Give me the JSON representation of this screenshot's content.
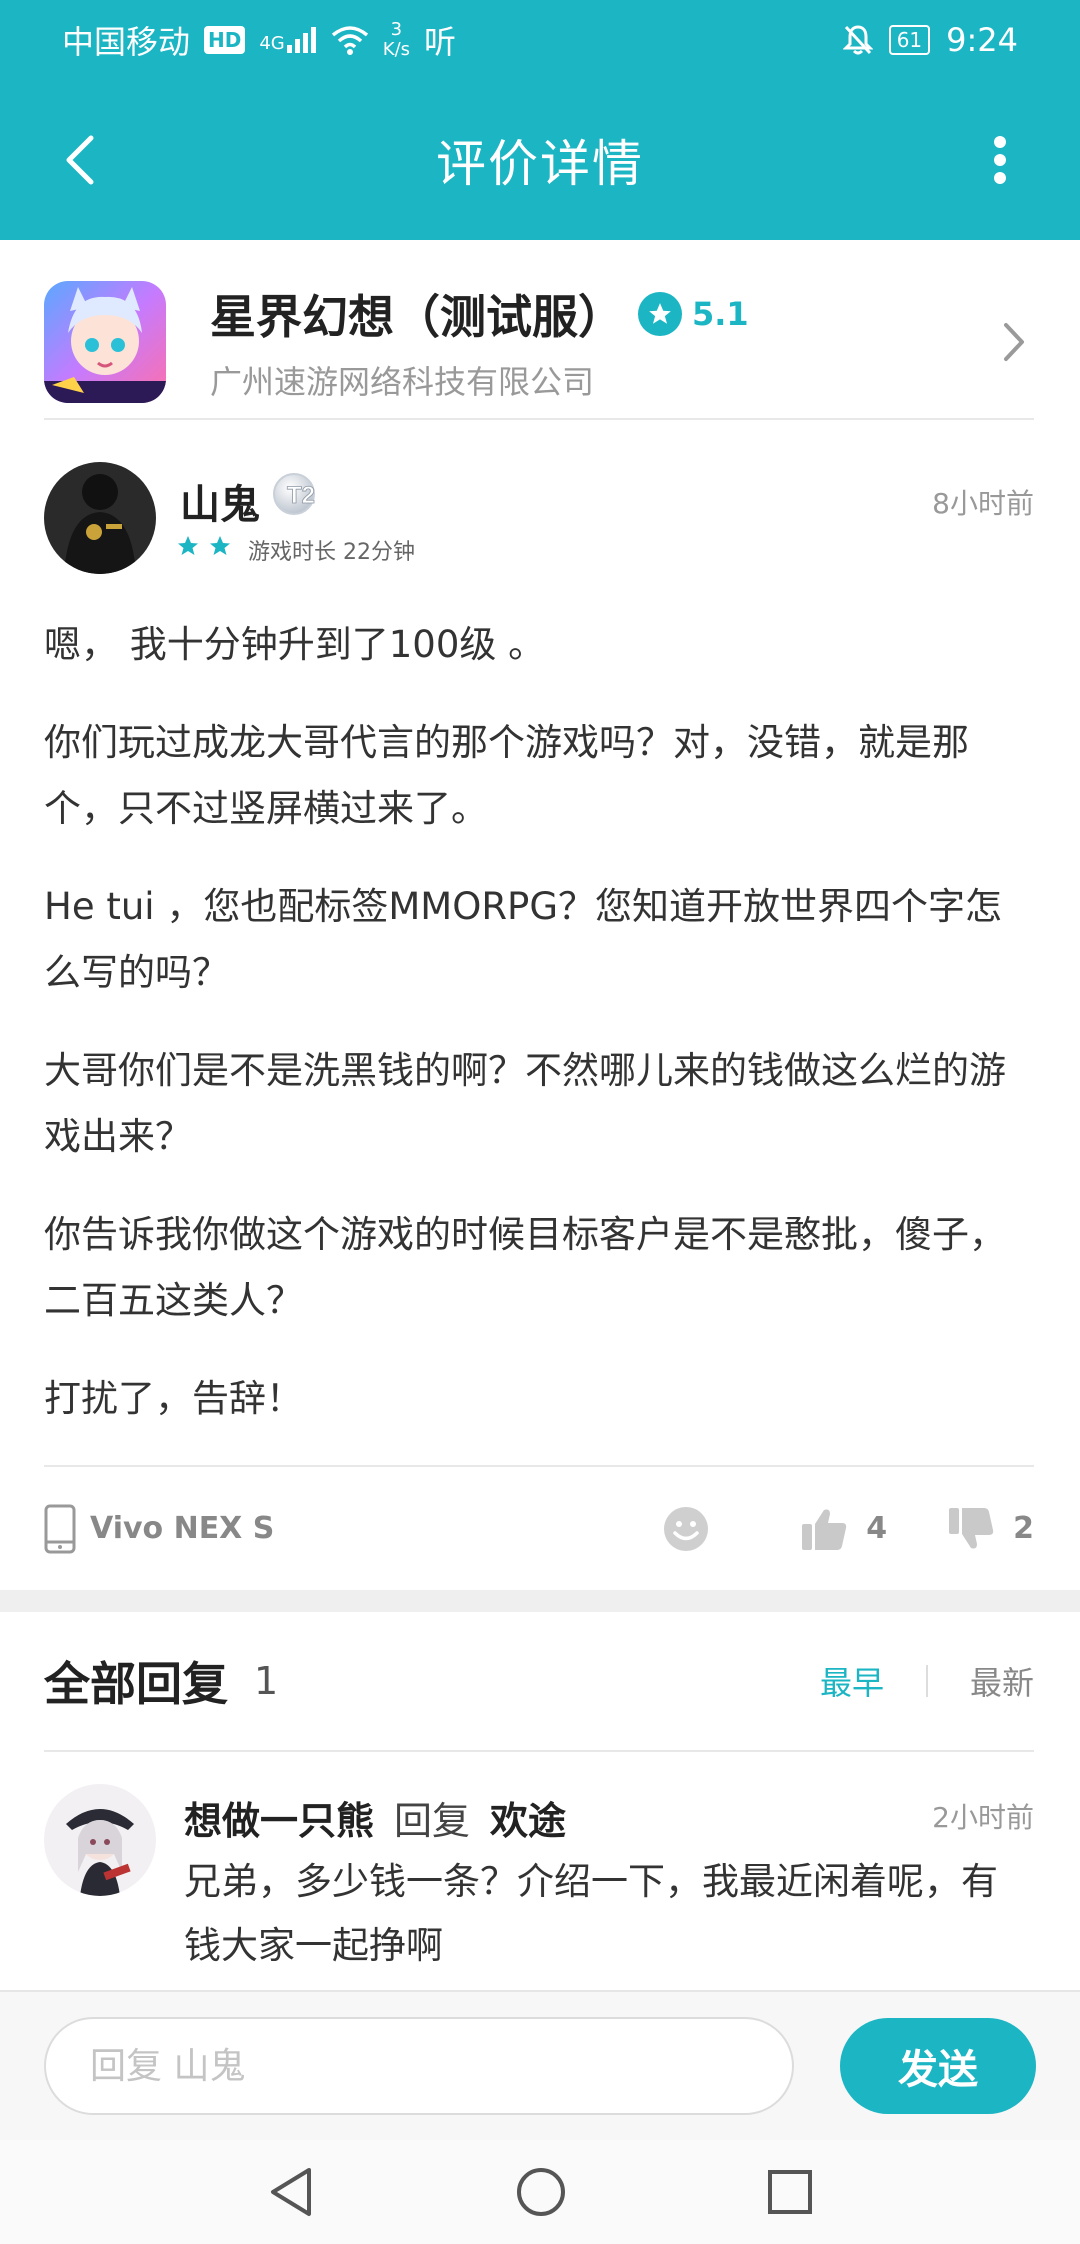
{
  "status_bar": {
    "carrier": "中国移动",
    "hd": "HD",
    "network": "4G",
    "speed_value": "3",
    "speed_unit": "K/s",
    "listen": "听",
    "battery": "61",
    "time": "9:24"
  },
  "header": {
    "title": "评价详情"
  },
  "game": {
    "title": "星界幻想（测试服）",
    "score": "5.1",
    "developer": "广州速游网络科技有限公司"
  },
  "review": {
    "user": "山鬼",
    "level": "T2",
    "rating": 2,
    "playtime": "游戏时长 22分钟",
    "time": "8小时前",
    "paragraphs": [
      "嗯， 我十分钟升到了100级 。",
      "你们玩过成龙大哥代言的那个游戏吗？对，没错，就是那个，只不过竖屏横过来了。",
      "He tui ，您也配标签MMORPG？您知道开放世界四个字怎么写的吗？",
      "大哥你们是不是洗黑钱的啊？不然哪儿来的钱做这么烂的游戏出来？",
      "你告诉我你做这个游戏的时候目标客户是不是憨批，傻子，二百五这类人？",
      "打扰了，告辞！"
    ],
    "device": "Vivo NEX S",
    "likes": "4",
    "dislikes": "2"
  },
  "replies": {
    "title": "全部回复",
    "count": "1",
    "sort_earliest": "最早",
    "sort_latest": "最新",
    "items": [
      {
        "user": "想做一只熊",
        "verb": "回复",
        "target": "欢途",
        "time": "2小时前",
        "text": "兄弟，多少钱一条？介绍一下，我最近闲着呢，有钱大家一起挣啊"
      }
    ]
  },
  "input": {
    "placeholder": "回复 山鬼",
    "send_label": "发送"
  },
  "colors": {
    "accent": "#1bb5c3",
    "text_dark": "#222222",
    "text_muted": "#999999"
  }
}
